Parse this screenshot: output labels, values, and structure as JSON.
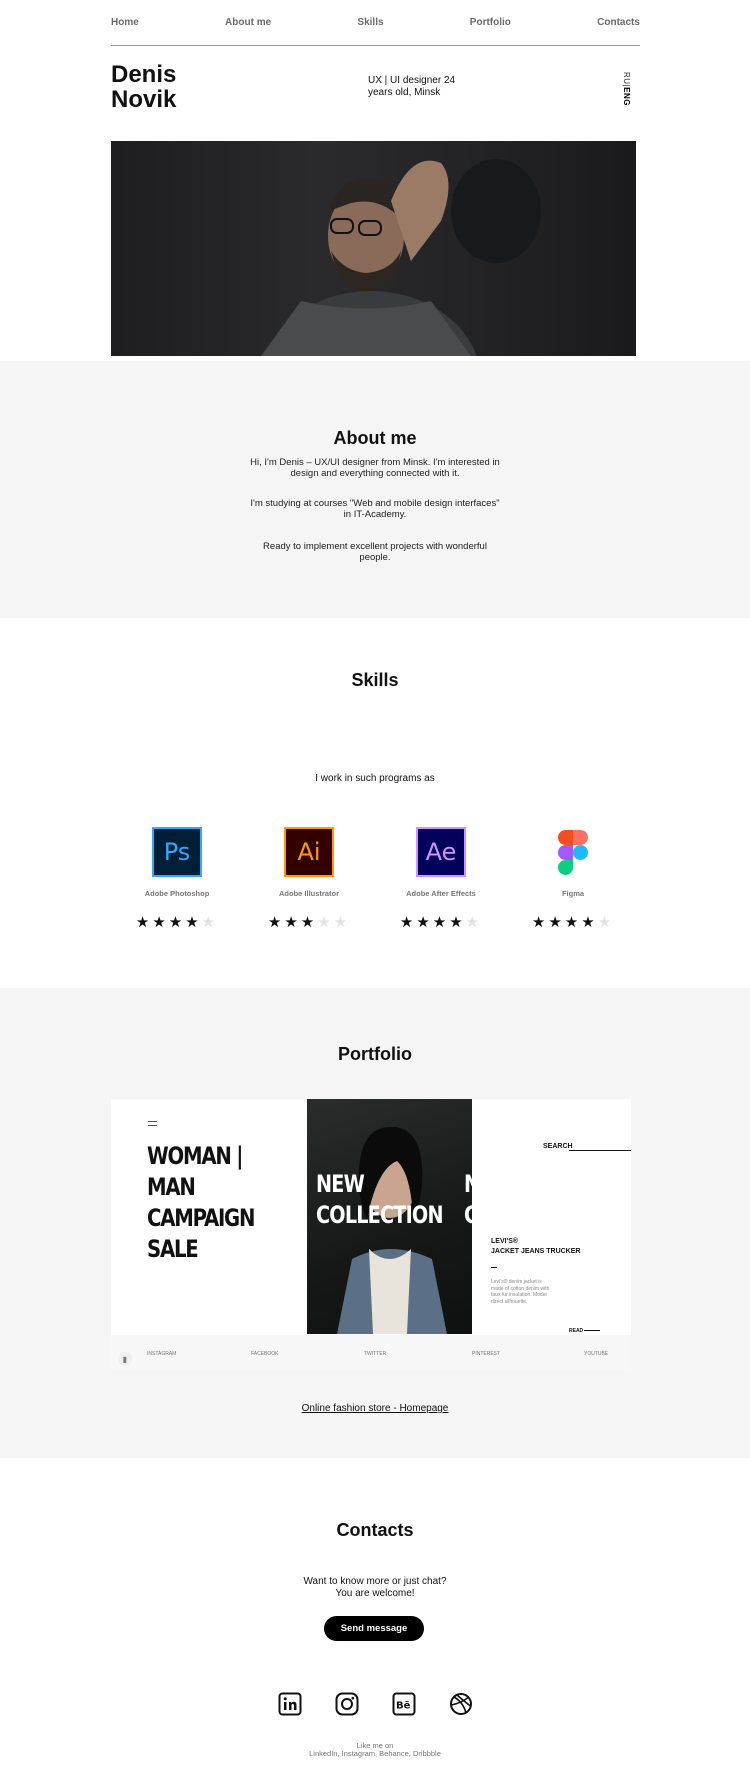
{
  "nav": {
    "items": [
      "Home",
      "About me",
      "Skills",
      "Portfolio",
      "Contacts"
    ]
  },
  "hero": {
    "first_name": "Denis",
    "last_name": "Novik",
    "intro": "UX | UI designer 24 years old, Minsk",
    "lang_ru": "RU",
    "lang_eng": "ENG"
  },
  "about": {
    "title": "About me",
    "paragraphs": [
      "Hi, I'm Denis – UX/UI designer from Minsk. I'm interested in design and everything connected with it.",
      "I'm studying at courses \"Web and mobile design interfaces\" in IT-Academy.",
      "Ready to implement excellent projects with wonderful people."
    ]
  },
  "skills": {
    "title": "Skills",
    "subtitle": "I work in such programs as",
    "items": [
      {
        "name": "Adobe Photoshop",
        "logo_text": "Ps",
        "rating": 4,
        "max": 5,
        "color": "#31a8ff",
        "bg": "#001e36",
        "icon": "photoshop-icon"
      },
      {
        "name": "Adobe Illustrator",
        "logo_text": "Ai",
        "rating": 3,
        "max": 5,
        "color": "#ff9a00",
        "bg": "#330000",
        "icon": "illustrator-icon"
      },
      {
        "name": "Adobe After Effects",
        "logo_text": "Ae",
        "rating": 4,
        "max": 5,
        "color": "#d291ff",
        "bg": "#00005b",
        "icon": "after-effects-icon"
      },
      {
        "name": "Figma",
        "logo_text": "",
        "rating": 4,
        "max": 5,
        "color": "#f24e1e",
        "bg": "#ffffff",
        "icon": "figma-icon"
      }
    ]
  },
  "portfolio": {
    "title": "Portfolio",
    "shot": {
      "campaign": [
        "WOMAN |",
        "MAN",
        "CAMPAIGN",
        "SALE"
      ],
      "collection": [
        "NEW",
        "COLLECTION"
      ],
      "collection_edge": [
        "N",
        "C"
      ],
      "search": "SEARCH",
      "brand": [
        "LEVI'S®",
        "JACKET JEANS TRUCKER"
      ],
      "description": "Levi's® denim jacket is made of cotton denim with faux fur insulation. Model direct silhouette.",
      "read": "READ",
      "social": [
        "INSTAGRAM",
        "FACEBOOK",
        "TWITTER",
        "PINTEREST",
        "YOUTUBE"
      ]
    },
    "link": "Online fashion store - Homepage"
  },
  "contacts": {
    "title": "Contacts",
    "text_line1": "Want to know more or just chat?",
    "text_line2": "You are welcome!",
    "button": "Send message",
    "icons": [
      "linkedin-icon",
      "instagram-icon",
      "behance-icon",
      "dribbble-icon"
    ],
    "like_line1": "Like me on",
    "like_line2": "LinkedIn, Instagram, Behance, Dribbble"
  }
}
